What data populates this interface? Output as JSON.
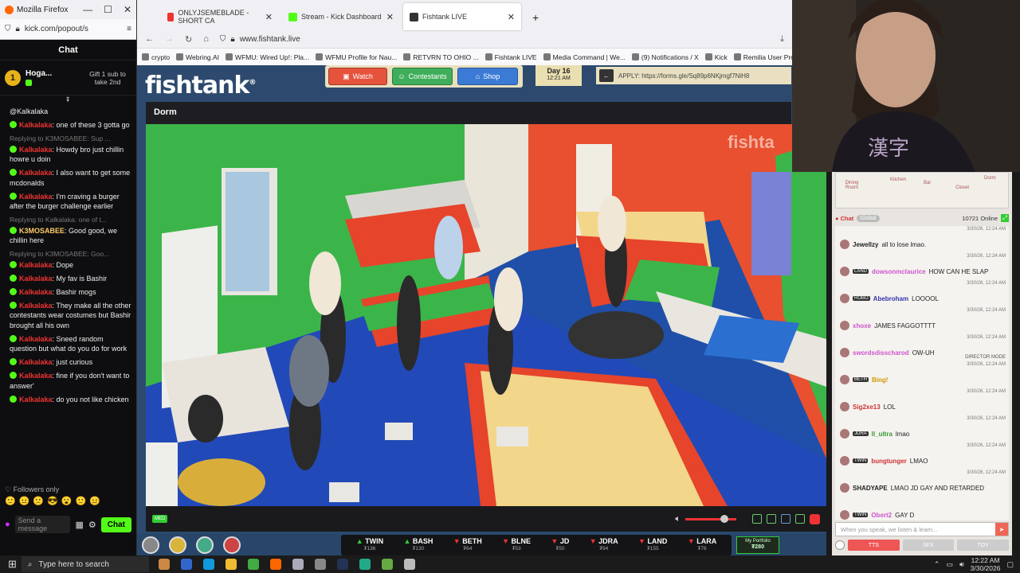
{
  "kick_window": {
    "title": "Mozilla Firefox",
    "url": "kick.com/popout/s",
    "chat_title": "Chat",
    "pinned": {
      "rank": "1",
      "name": "Hoga...",
      "gift_text": "Gift 1 sub to take 2nd"
    },
    "messages": [
      {
        "mention": "@Kalkalaka"
      },
      {
        "user": "Kalkalaka",
        "text": ": one of these 3 gotta go"
      },
      {
        "reply": "Replying to K3MOSABEE: Sup ...",
        "user": "Kalkalaka",
        "text": ": Howdy bro just chillin howre u doin"
      },
      {
        "user": "Kalkalaka",
        "text": ": I also want to get some mcdonalds"
      },
      {
        "user": "Kalkalaka",
        "text": ": I'm craving a burger after the burger challenge earlier"
      },
      {
        "reply": "Replying to Kalkalaka: one of t...",
        "user": "K3MOSABEE",
        "text": ": Good good, we chillin here",
        "alt": true
      },
      {
        "reply": "Replying to K3MOSABEE: Goo...",
        "user": "Kalkalaka",
        "text": ": Dope"
      },
      {
        "user": "Kalkalaka",
        "text": ": My fav is Bashir"
      },
      {
        "user": "Kalkalaka",
        "text": ": Bashir mogs"
      },
      {
        "user": "Kalkalaka",
        "text": ": They make all the other contestants wear costumes but Bashir brought all his own"
      },
      {
        "user": "Kalkalaka",
        "text": ": Sneed random question but what do you do for work"
      },
      {
        "user": "Kalkalaka",
        "text": ": just curious"
      },
      {
        "user": "Kalkalaka",
        "text": ": fine if you don't want to answer'"
      },
      {
        "user": "Kalkalaka",
        "text": ": do you not like chicken"
      }
    ],
    "followers_only": "Followers only",
    "send_placeholder": "Send a message",
    "chat_button": "Chat"
  },
  "browser": {
    "tabs": [
      {
        "label": "ONLYJSEMEBLADE - SHORT CA",
        "color": "#e33"
      },
      {
        "label": "Stream - Kick Dashboard",
        "color": "#53fc18"
      },
      {
        "label": "Fishtank LIVE",
        "color": "#333",
        "active": true
      }
    ],
    "address": "www.fishtank.live",
    "bookmarks": [
      "crypto",
      "Webring.AI",
      "WFMU: Wired Up!: Pla...",
      "WFMU Profile for Nau...",
      "RETVRN TO OHIO ...",
      "Fishtank LIVE",
      "Media Command | We...",
      "(9) Notifications / X",
      "Kick",
      "Remilia User Profiles"
    ]
  },
  "fishtank": {
    "logo": "fishtank",
    "logo_mark": "®",
    "buttons": {
      "watch": "Watch",
      "contestants": "Contestants",
      "shop": "Shop"
    },
    "day": "Day 16",
    "day_time": "12:21 AM",
    "apply": "APPLY: https://forms.gle/Sq89p6NKjmgf7NiH8",
    "camera_name": "Dorm",
    "watermark": "fishta",
    "live_tag": "MED",
    "contestants": [
      {
        "name": "TWIN",
        "val": "₮136",
        "dir": "up"
      },
      {
        "name": "BASH",
        "val": "₮130",
        "dir": "up"
      },
      {
        "name": "BETH",
        "val": "₮64",
        "dir": "down"
      },
      {
        "name": "BLNE",
        "val": "₮53",
        "dir": "down"
      },
      {
        "name": "JD",
        "val": "₮50",
        "dir": "down"
      },
      {
        "name": "JDRA",
        "val": "₮94",
        "dir": "down"
      },
      {
        "name": "LAND",
        "val": "₮155",
        "dir": "down"
      },
      {
        "name": "LARA",
        "val": "₮76",
        "dir": "down"
      }
    ],
    "portfolio_label": "My Portfolio",
    "portfolio_value": "₮280",
    "map_rooms": [
      "Dining Room",
      "Kitchen",
      "Bar",
      "Closet",
      "Dorm"
    ],
    "chat_label": "Chat",
    "global_label": "Global",
    "online": "10721 Online",
    "chat": [
      {
        "ts": "3/30/26, 12:24 AM",
        "user": "Jewellzy",
        "text": "all to lose lmao.",
        "color": "#222"
      },
      {
        "ts": "3/30/26, 12:24 AM",
        "tag": "LAND",
        "user": "dowsonmclaurice",
        "text": "HOW CAN HE SLAP",
        "color": "#c5c"
      },
      {
        "ts": "3/30/26, 12:24 AM",
        "tag": "ROBO",
        "user": "Abebroham",
        "text": "LOOOOL",
        "color": "#33a"
      },
      {
        "ts": "3/30/26, 12:24 AM",
        "user": "xhoxe",
        "text": "JAMES FAGGOTTTT",
        "color": "#c5c"
      },
      {
        "ts": "3/30/26, 12:24 AM",
        "user": "swordsdisscharod",
        "text": "OW-UH",
        "color": "#c5c"
      },
      {
        "ts": "3/30/26, 12:24 AM",
        "mode": "DIRECTOR MODE",
        "tag": "BETH",
        "user": "Bing!",
        "text": "",
        "color": "#c90"
      },
      {
        "ts": "3/30/26, 12:24 AM",
        "user": "Sig2xe13",
        "text": "LOL",
        "color": "#c33"
      },
      {
        "ts": "3/30/26, 12:24 AM",
        "tag": "JDRA",
        "user": "ll_ultra",
        "text": "lmao",
        "color": "#393"
      },
      {
        "ts": "3/30/26, 12:24 AM",
        "tag": "TWIN",
        "user": "bungtunger",
        "text": "LMAO",
        "color": "#c33"
      },
      {
        "ts": "3/30/26, 12:24 AM",
        "user": "SHADYAPE",
        "text": "LMAO JD GAY AND RETARDED",
        "color": "#222"
      },
      {
        "ts": "",
        "tag": "TWIN",
        "user": "Obert2",
        "text": "GAY D",
        "color": "#c5c"
      }
    ],
    "input_placeholder": "When you speak, we listen & learn...",
    "tts": "TTS",
    "sfx": "SFX",
    "toy": "TOY"
  },
  "taskbar": {
    "search": "Type here to search",
    "time": "12:22 AM",
    "date": "3/30/2026"
  },
  "colors": {
    "kick_green": "#53fc18",
    "watch_red": "#e5533d",
    "contestants_green": "#3fae5a",
    "shop_blue": "#3b7bd6"
  }
}
